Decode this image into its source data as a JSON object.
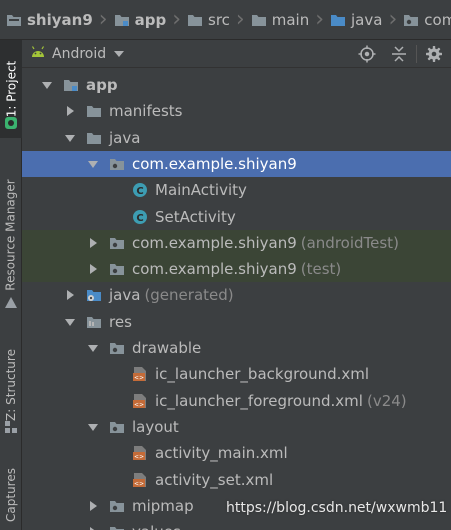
{
  "breadcrumb": [
    {
      "label": "shiyan9",
      "icon": "project-folder-icon",
      "bold": true
    },
    {
      "label": "app",
      "icon": "module-folder-icon",
      "bold": true
    },
    {
      "label": "src",
      "icon": "folder-icon",
      "bold": false
    },
    {
      "label": "main",
      "icon": "folder-icon",
      "bold": false
    },
    {
      "label": "java",
      "icon": "source-folder-icon",
      "bold": false
    },
    {
      "label": "com",
      "icon": "package-icon",
      "bold": false
    },
    {
      "label": "",
      "icon": "folder-icon",
      "bold": false
    }
  ],
  "side_tabs": {
    "project": "1: Project",
    "resource_manager": "Resource Manager",
    "structure": "Z: Structure",
    "captures": "Captures"
  },
  "toolbar": {
    "view_label": "Android",
    "icons": [
      "android-icon",
      "locate-target-icon",
      "collapse-all-icon",
      "settings-gear-icon"
    ]
  },
  "tree": [
    {
      "label": "app",
      "suffix": "",
      "indent": 0,
      "arrow": "down",
      "icon": "module-folder-icon",
      "bold": true,
      "state": ""
    },
    {
      "label": "manifests",
      "suffix": "",
      "indent": 1,
      "arrow": "right",
      "icon": "folder-icon",
      "bold": false,
      "state": ""
    },
    {
      "label": "java",
      "suffix": "",
      "indent": 1,
      "arrow": "down",
      "icon": "folder-icon",
      "bold": false,
      "state": ""
    },
    {
      "label": "com.example.shiyan9",
      "suffix": "",
      "indent": 2,
      "arrow": "down",
      "icon": "package-icon",
      "bold": false,
      "state": "selected"
    },
    {
      "label": "MainActivity",
      "suffix": "",
      "indent": 3,
      "arrow": "",
      "icon": "java-class-icon",
      "bold": false,
      "state": ""
    },
    {
      "label": "SetActivity",
      "suffix": "",
      "indent": 3,
      "arrow": "",
      "icon": "java-class-icon",
      "bold": false,
      "state": ""
    },
    {
      "label": "com.example.shiyan9",
      "suffix": "(androidTest)",
      "indent": 2,
      "arrow": "right",
      "icon": "package-icon",
      "bold": false,
      "state": "green"
    },
    {
      "label": "com.example.shiyan9",
      "suffix": "(test)",
      "indent": 2,
      "arrow": "right",
      "icon": "package-icon",
      "bold": false,
      "state": "green"
    },
    {
      "label": "java",
      "suffix": "(generated)",
      "indent": 1,
      "arrow": "right",
      "icon": "generated-folder-icon",
      "bold": false,
      "state": ""
    },
    {
      "label": "res",
      "suffix": "",
      "indent": 1,
      "arrow": "down",
      "icon": "resource-folder-icon",
      "bold": false,
      "state": ""
    },
    {
      "label": "drawable",
      "suffix": "",
      "indent": 2,
      "arrow": "down",
      "icon": "package-icon",
      "bold": false,
      "state": ""
    },
    {
      "label": "ic_launcher_background.xml",
      "suffix": "",
      "indent": 3,
      "arrow": "",
      "icon": "xml-file-icon",
      "bold": false,
      "state": ""
    },
    {
      "label": "ic_launcher_foreground.xml",
      "suffix": "(v24)",
      "indent": 3,
      "arrow": "",
      "icon": "xml-file-icon",
      "bold": false,
      "state": ""
    },
    {
      "label": "layout",
      "suffix": "",
      "indent": 2,
      "arrow": "down",
      "icon": "package-icon",
      "bold": false,
      "state": ""
    },
    {
      "label": "activity_main.xml",
      "suffix": "",
      "indent": 3,
      "arrow": "",
      "icon": "xml-file-icon",
      "bold": false,
      "state": ""
    },
    {
      "label": "activity_set.xml",
      "suffix": "",
      "indent": 3,
      "arrow": "",
      "icon": "xml-file-icon",
      "bold": false,
      "state": ""
    },
    {
      "label": "mipmap",
      "suffix": "",
      "indent": 2,
      "arrow": "right",
      "icon": "package-icon",
      "bold": false,
      "state": ""
    },
    {
      "label": "values",
      "suffix": "",
      "indent": 2,
      "arrow": "right",
      "icon": "package-icon",
      "bold": false,
      "state": ""
    }
  ],
  "watermark": "https://blog.csdn.net/wxwmb11",
  "colors": {
    "background": "#3c3f41",
    "selection": "#4b6eaf",
    "test_highlight": "#3b4536",
    "folder": "#87939a",
    "source_folder": "#4a8bc7",
    "java_class": "#3d9db3",
    "android_green": "#a4c639",
    "xml_orange": "#c46b38"
  }
}
